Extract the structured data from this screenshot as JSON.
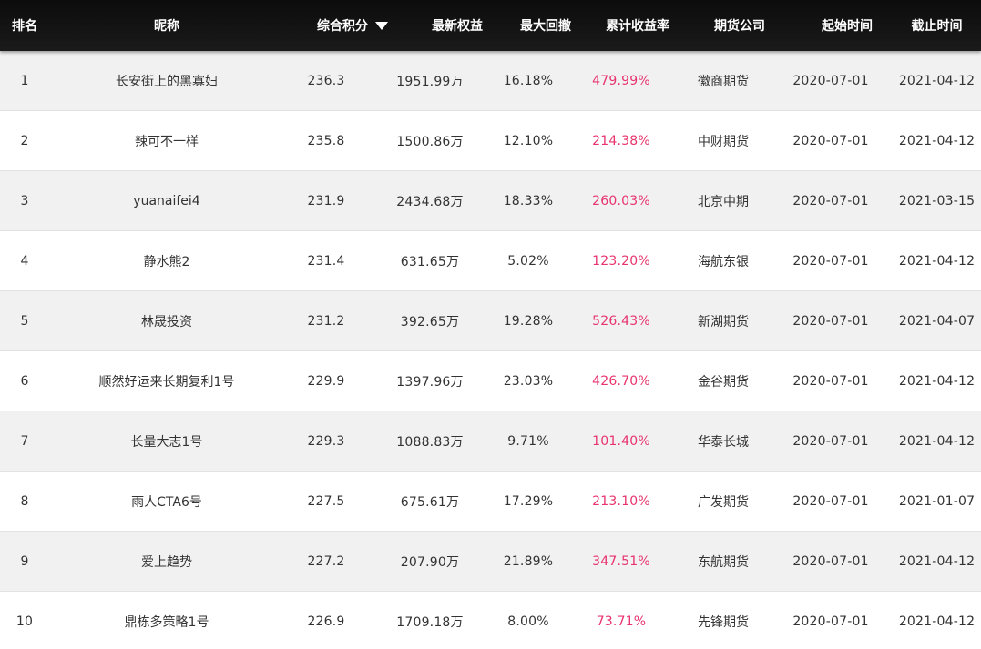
{
  "header": {
    "rank": "排名",
    "nickname": "昵称",
    "score": "综合积分",
    "equity": "最新权益",
    "drawdown": "最大回撤",
    "return": "累计收益率",
    "broker": "期货公司",
    "start": "起始时间",
    "end": "截止时间",
    "sort_icon": "triangle-down-icon"
  },
  "colors": {
    "header_bg": "#111111",
    "return_text": "#e8336e",
    "odd_row": "#f1f1f1"
  },
  "rows": [
    {
      "rank": "1",
      "name": "长安街上的黑寡妇",
      "score": "236.3",
      "equity": "1951.99万",
      "drawdown": "16.18%",
      "return": "479.99%",
      "broker": "徽商期货",
      "start": "2020-07-01",
      "end": "2021-04-12"
    },
    {
      "rank": "2",
      "name": "辣可不一样",
      "score": "235.8",
      "equity": "1500.86万",
      "drawdown": "12.10%",
      "return": "214.38%",
      "broker": "中财期货",
      "start": "2020-07-01",
      "end": "2021-04-12"
    },
    {
      "rank": "3",
      "name": "yuanaifei4",
      "score": "231.9",
      "equity": "2434.68万",
      "drawdown": "18.33%",
      "return": "260.03%",
      "broker": "北京中期",
      "start": "2020-07-01",
      "end": "2021-03-15"
    },
    {
      "rank": "4",
      "name": "静水熊2",
      "score": "231.4",
      "equity": "631.65万",
      "drawdown": "5.02%",
      "return": "123.20%",
      "broker": "海航东银",
      "start": "2020-07-01",
      "end": "2021-04-12"
    },
    {
      "rank": "5",
      "name": "林晟投资",
      "score": "231.2",
      "equity": "392.65万",
      "drawdown": "19.28%",
      "return": "526.43%",
      "broker": "新湖期货",
      "start": "2020-07-01",
      "end": "2021-04-07"
    },
    {
      "rank": "6",
      "name": "顺然好运来长期复利1号",
      "score": "229.9",
      "equity": "1397.96万",
      "drawdown": "23.03%",
      "return": "426.70%",
      "broker": "金谷期货",
      "start": "2020-07-01",
      "end": "2021-04-12"
    },
    {
      "rank": "7",
      "name": "长量大志1号",
      "score": "229.3",
      "equity": "1088.83万",
      "drawdown": "9.71%",
      "return": "101.40%",
      "broker": "华泰长城",
      "start": "2020-07-01",
      "end": "2021-04-12"
    },
    {
      "rank": "8",
      "name": "雨人CTA6号",
      "score": "227.5",
      "equity": "675.61万",
      "drawdown": "17.29%",
      "return": "213.10%",
      "broker": "广发期货",
      "start": "2020-07-01",
      "end": "2021-01-07"
    },
    {
      "rank": "9",
      "name": "爱上趋势",
      "score": "227.2",
      "equity": "207.90万",
      "drawdown": "21.89%",
      "return": "347.51%",
      "broker": "东航期货",
      "start": "2020-07-01",
      "end": "2021-04-12"
    },
    {
      "rank": "10",
      "name": "鼎栋多策略1号",
      "score": "226.9",
      "equity": "1709.18万",
      "drawdown": "8.00%",
      "return": "73.71%",
      "broker": "先锋期货",
      "start": "2020-07-01",
      "end": "2021-04-12"
    }
  ]
}
